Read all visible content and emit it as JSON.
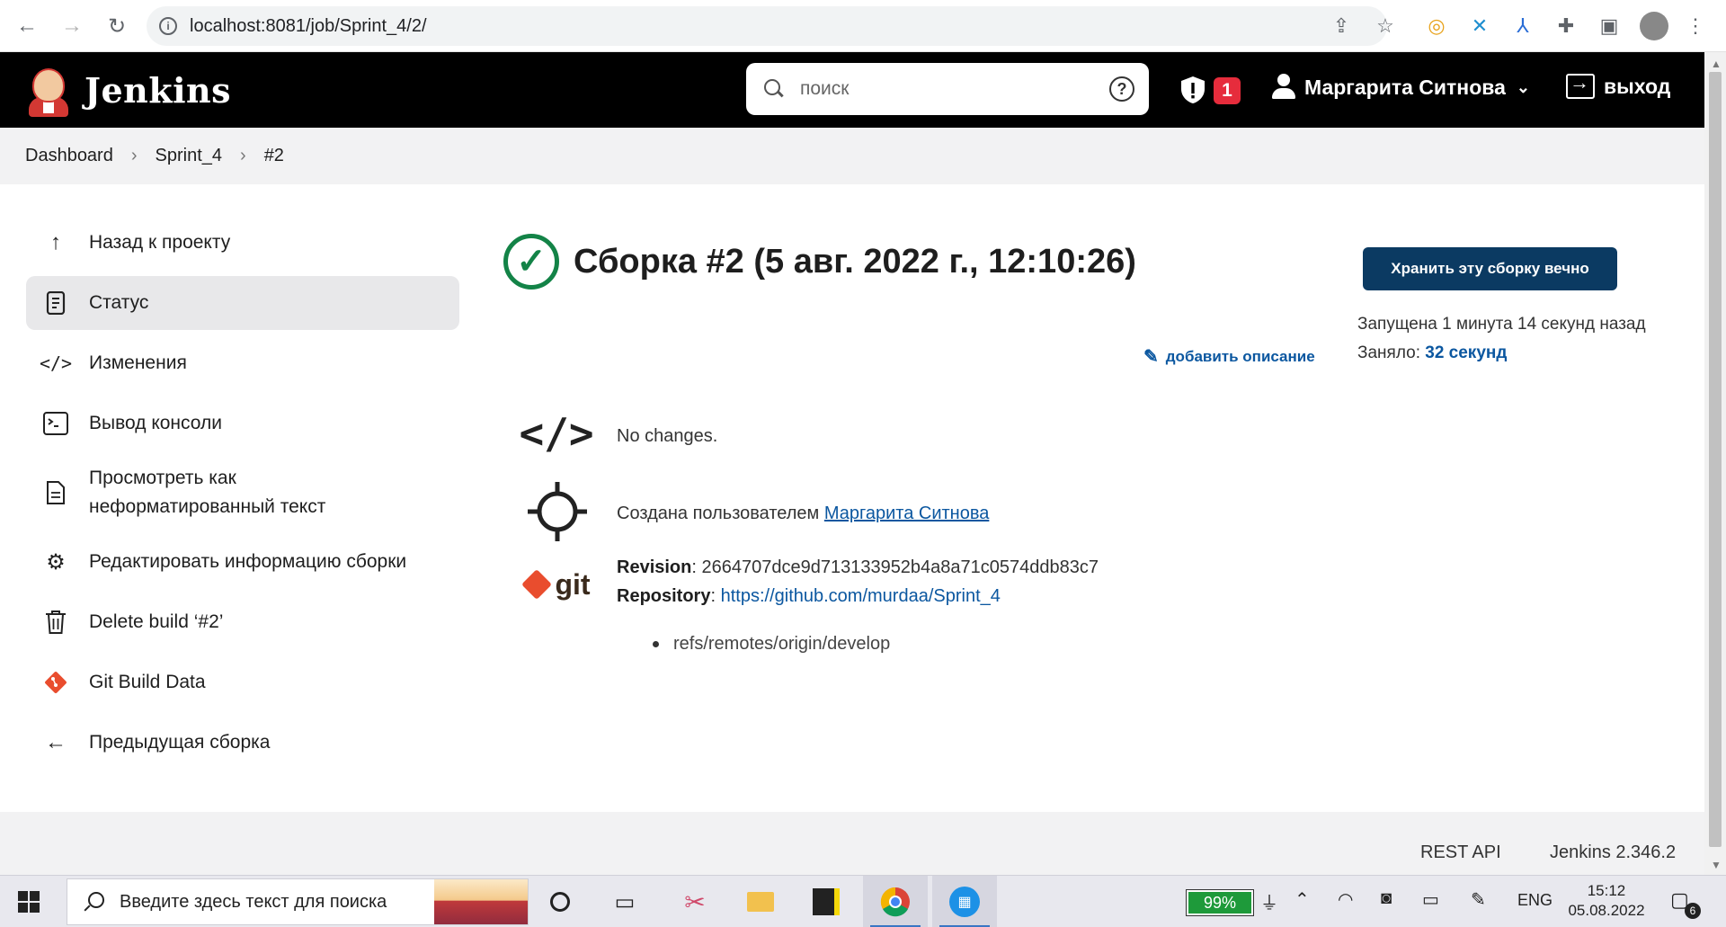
{
  "browser": {
    "url": "localhost:8081/job/Sprint_4/2/"
  },
  "header": {
    "brand": "Jenkins",
    "search_placeholder": "поиск",
    "security_count": "1",
    "user_name": "Маргарита Ситнова",
    "logout_label": "выход"
  },
  "breadcrumb": [
    "Dashboard",
    "Sprint_4",
    "#2"
  ],
  "sidebar": {
    "items": [
      {
        "label": "Назад к проекту",
        "icon": "arrow-up-icon"
      },
      {
        "label": "Статус",
        "icon": "document-icon"
      },
      {
        "label": "Изменения",
        "icon": "code-icon"
      },
      {
        "label": "Вывод консоли",
        "icon": "terminal-icon"
      },
      {
        "label": "Просмотреть как неформатированный текст",
        "icon": "file-icon"
      },
      {
        "label": "Редактировать информацию сборки",
        "icon": "gear-icon"
      },
      {
        "label": "Delete build ‘#2’",
        "icon": "trash-icon"
      },
      {
        "label": "Git Build Data",
        "icon": "git-icon"
      },
      {
        "label": "Предыдущая сборка",
        "icon": "arrow-left-icon"
      }
    ],
    "active_index": 1
  },
  "main": {
    "title": "Сборка #2 (5 авг. 2022 г., 12:10:26)",
    "status": "success",
    "keep_button": "Хранить эту сборку вечно",
    "started_text": "Запущена 1 минута 14 секунд назад",
    "duration_label": "Заняло:",
    "duration_value": "32 секунд",
    "add_description": "добавить описание",
    "changes_text": "No changes.",
    "created_by_prefix": "Создана пользователем",
    "created_by_user": "Маргарита Ситнова",
    "revision_label": "Revision",
    "revision_value": ": 2664707dce9d713133952b4a8a71c0574ddb83c7",
    "repository_label": "Repository",
    "repository_sep": ": ",
    "repository_url": "https://github.com/murdaa/Sprint_4",
    "branches": [
      "refs/remotes/origin/develop"
    ],
    "git_logo_text": "git"
  },
  "footer": {
    "rest_api": "REST API",
    "version": "Jenkins 2.346.2"
  },
  "taskbar": {
    "search_placeholder": "Введите здесь текст для поиска",
    "battery": "99%",
    "language": "ENG",
    "time": "15:12",
    "date": "05.08.2022",
    "notifications": "6"
  },
  "colors": {
    "header_bg": "#000000",
    "success_green": "#138347",
    "keep_button_bg": "#0b3a62",
    "link_blue": "#0b57a0",
    "badge_red": "#e62c3c"
  }
}
